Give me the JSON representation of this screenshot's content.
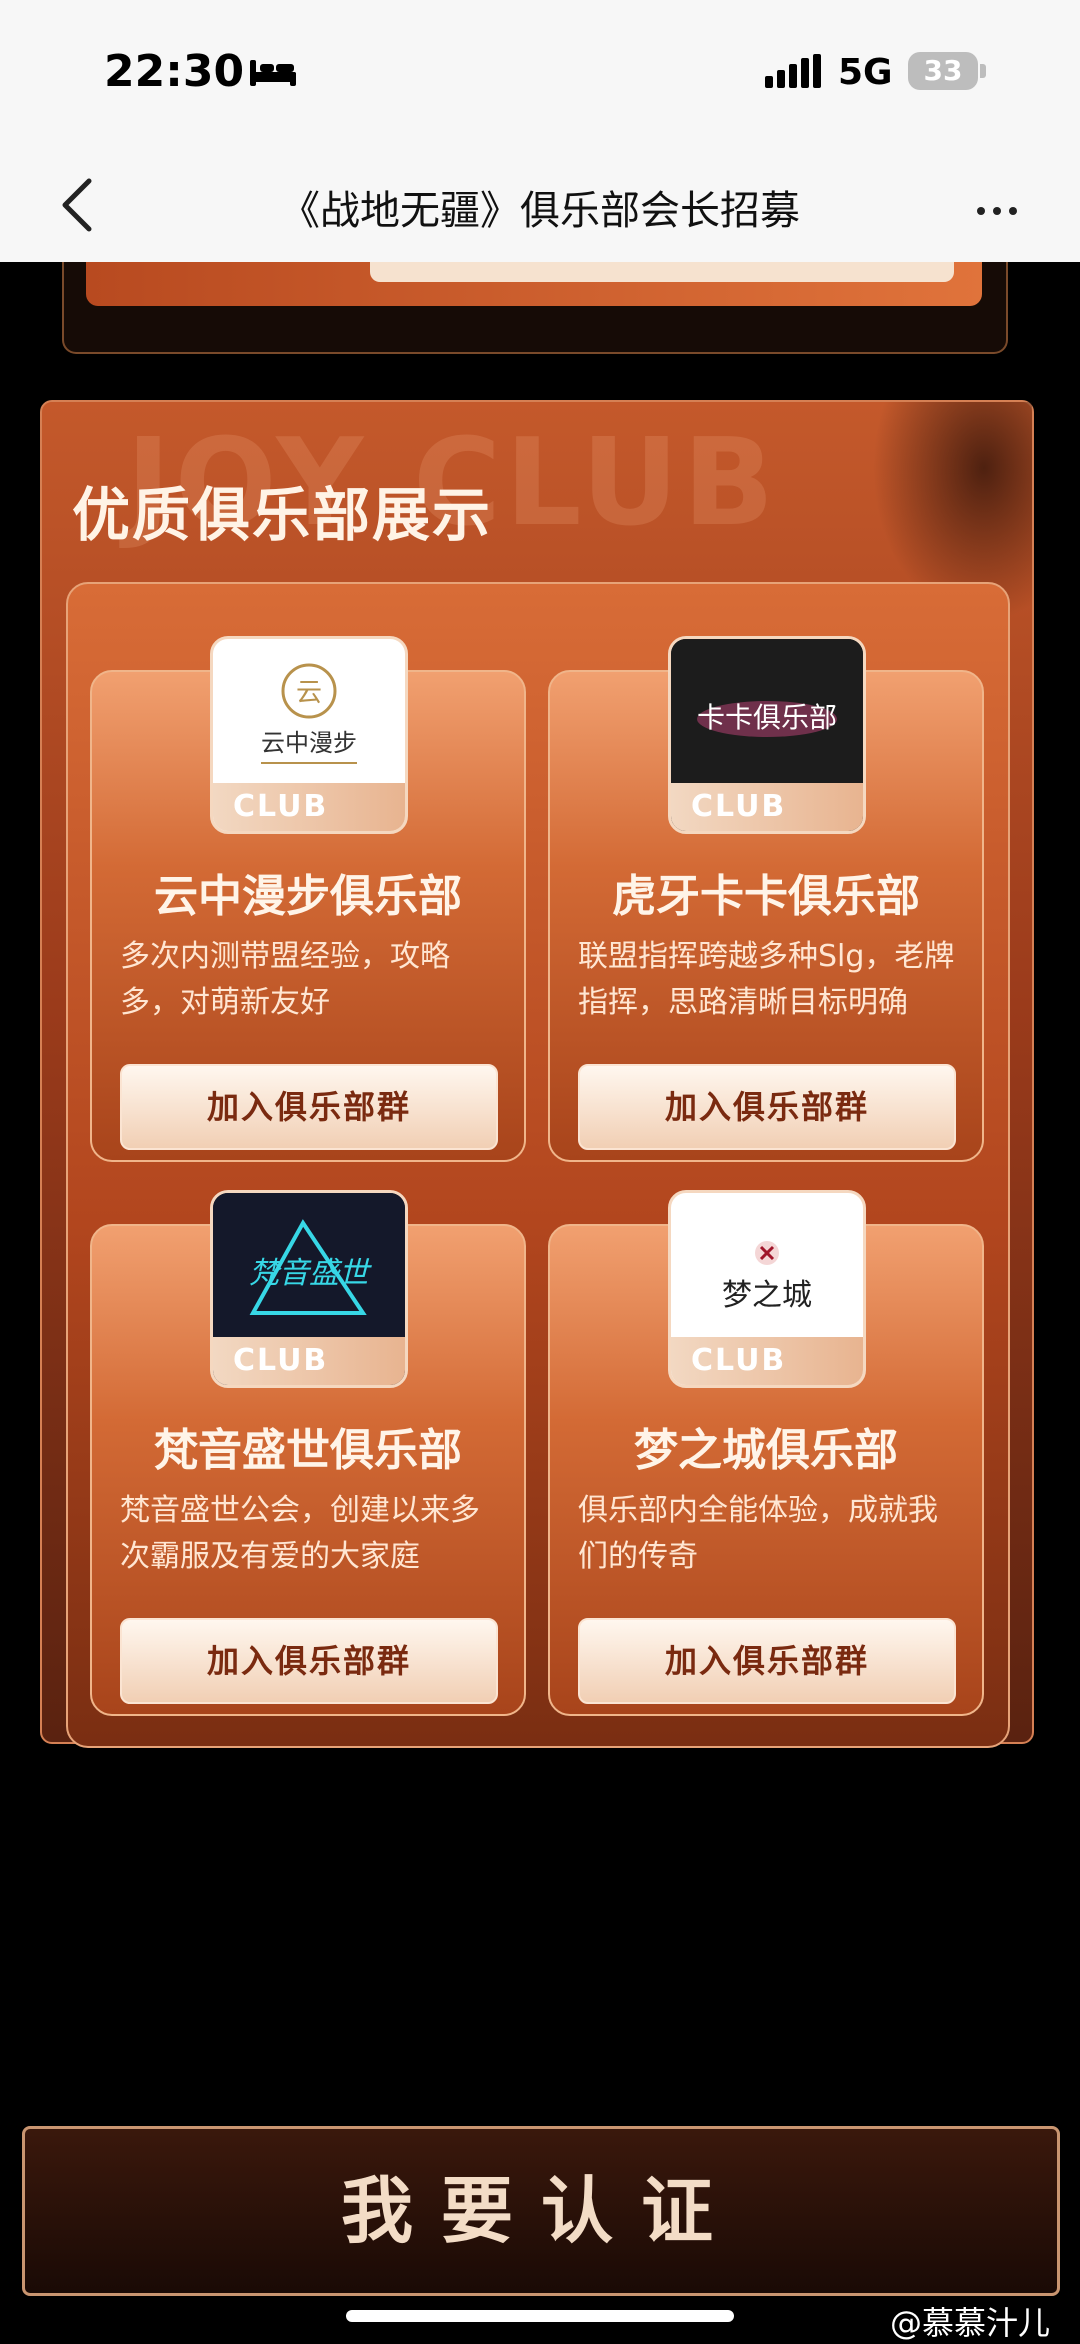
{
  "status_bar": {
    "time": "22:30",
    "network": "5G",
    "battery": "33"
  },
  "nav": {
    "title": "《战地无疆》俱乐部会长招募"
  },
  "section": {
    "watermark": "JOY CLUB",
    "title": "优质俱乐部展示"
  },
  "clubs": [
    {
      "logo_text": "云中漫步",
      "badge": "CLUB",
      "name": "云中漫步俱乐部",
      "desc": "多次内测带盟经验，攻略多，对萌新友好",
      "join_label": "加入俱乐部群"
    },
    {
      "logo_text": "卡卡俱乐部",
      "badge": "CLUB",
      "name": "虎牙卡卡俱乐部",
      "desc": "联盟指挥跨越多种Slg，老牌指挥，思路清晰目标明确",
      "join_label": "加入俱乐部群"
    },
    {
      "logo_text": "梵音盛世",
      "badge": "CLUB",
      "name": "梵音盛世俱乐部",
      "desc": "梵音盛世公会，创建以来多次霸服及有爱的大家庭",
      "join_label": "加入俱乐部群"
    },
    {
      "logo_text": "梦之城",
      "badge": "CLUB",
      "name": "梦之城俱乐部",
      "desc": "俱乐部内全能体验，成就我们的传奇",
      "join_label": "加入俱乐部群"
    }
  ],
  "cta": {
    "label": "我要认证"
  },
  "watermark_weibo": "@慕慕汁儿"
}
